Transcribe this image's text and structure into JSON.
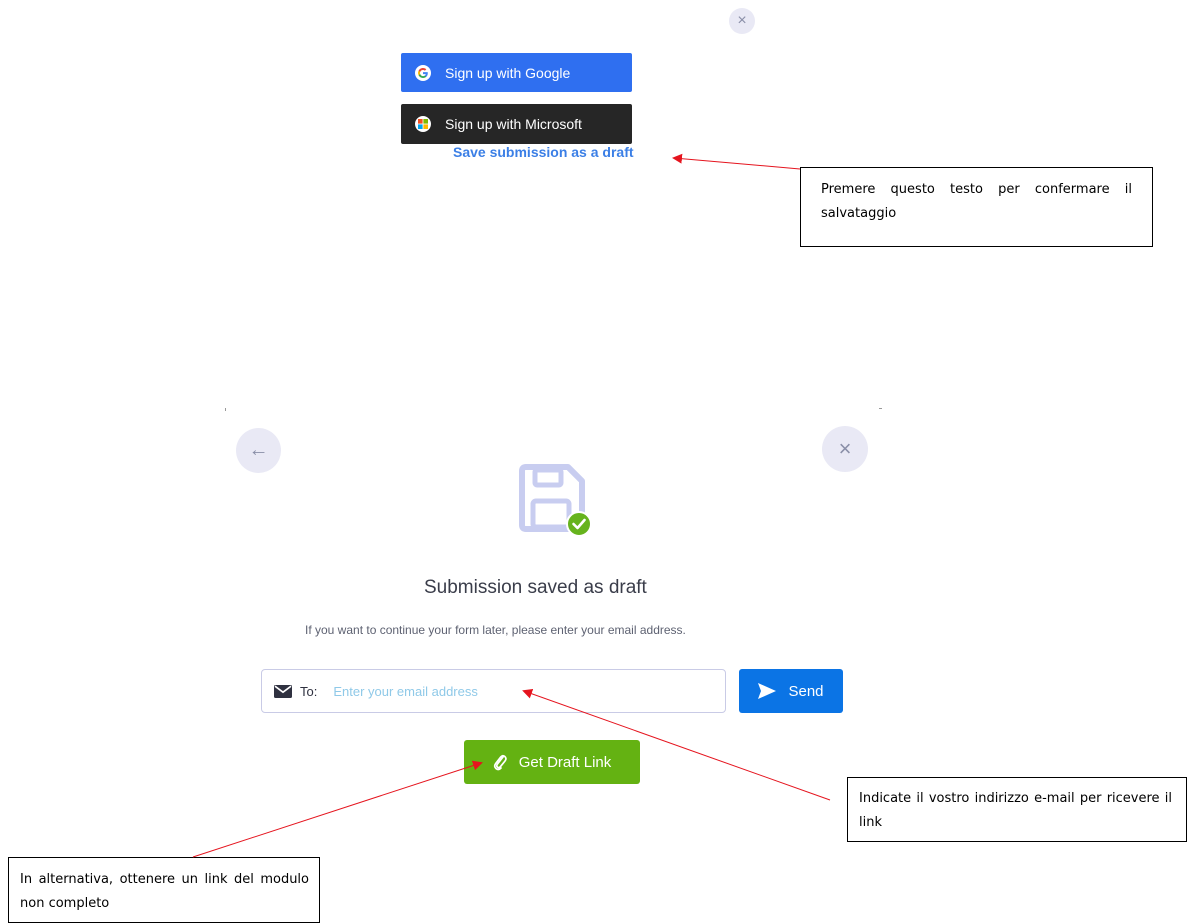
{
  "top_panel": {
    "close_glyph": "×",
    "google_button": {
      "label": "Sign up with Google",
      "color": "#2f6ff0"
    },
    "microsoft_button": {
      "label": "Sign up with Microsoft",
      "color": "#262626"
    },
    "save_draft_link": "Save submission as a draft"
  },
  "saved_panel": {
    "back_glyph": "←",
    "close_glyph": "×",
    "title": "Submission saved as draft",
    "subtitle": "If you want to continue your form later, please enter your email address.",
    "email": {
      "to_label": "To:",
      "placeholder": "Enter your email address",
      "value": ""
    },
    "send_button": "Send",
    "get_link_button": "Get Draft Link",
    "colors": {
      "send": "#0b74e5",
      "get_link": "#64b212",
      "check": "#66b31d",
      "floppy": "#c8cdf0"
    }
  },
  "annotations": {
    "save_note": "Premere questo testo per confermare il salvataggio",
    "email_note": "Indicate il vostro indirizzo e-mail per ricevere il link",
    "link_note": "In alternativa, ottenere un link del modulo non completo",
    "arrow_color": "#e5141e"
  }
}
